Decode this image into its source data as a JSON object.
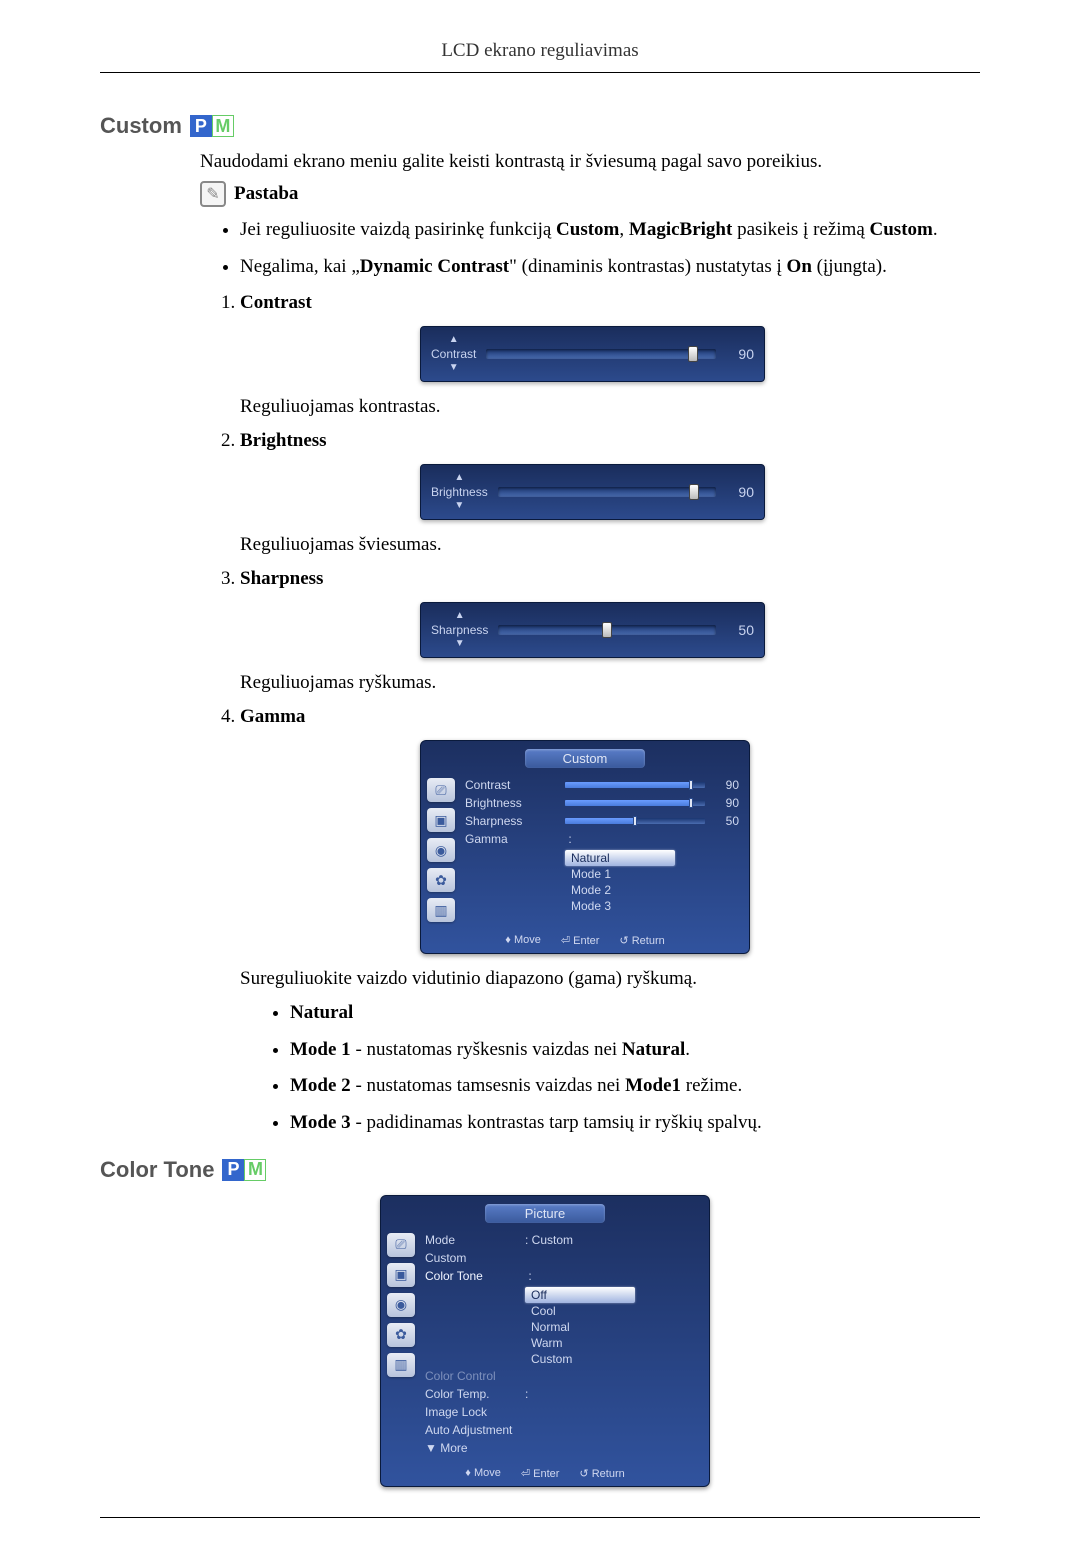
{
  "header": "LCD ekrano reguliavimas",
  "section1": {
    "title": "Custom",
    "intro": "Naudodami ekrano meniu galite keisti kontrastą ir šviesumą pagal savo poreikius.",
    "note_label": "Pastaba",
    "bullet1_pre": "Jei reguliuosite vaizdą pasirinkę funkciją ",
    "bullet1_b1": "Custom",
    "bullet1_mid": ", ",
    "bullet1_b2": "MagicBright",
    "bullet1_mid2": " pasikeis į režimą ",
    "bullet1_b3": "Custom",
    "bullet1_end": ".",
    "bullet2_pre": "Negalima, kai „",
    "bullet2_b1": "Dynamic Contrast",
    "bullet2_mid": "\" (dinaminis kontrastas) nustatytas į ",
    "bullet2_b2": "On",
    "bullet2_end": " (įjungta).",
    "items": [
      {
        "label": "Contrast",
        "slider_name": "Contrast",
        "value": "90",
        "thumb_pct": 90,
        "desc": "Reguliuojamas kontrastas."
      },
      {
        "label": "Brightness",
        "slider_name": "Brightness",
        "value": "90",
        "thumb_pct": 90,
        "desc": "Reguliuojamas šviesumas."
      },
      {
        "label": "Sharpness",
        "slider_name": "Sharpness",
        "value": "50",
        "thumb_pct": 50,
        "desc": "Reguliuojamas ryškumas."
      },
      {
        "label": "Gamma"
      }
    ]
  },
  "gamma_osd": {
    "tab": "Custom",
    "rows": [
      {
        "label": "Contrast",
        "val": "90",
        "pct": 90
      },
      {
        "label": "Brightness",
        "val": "90",
        "pct": 90
      },
      {
        "label": "Sharpness",
        "val": "50",
        "pct": 50
      }
    ],
    "gamma_label": "Gamma",
    "gamma_value_sel": "Natural",
    "options": [
      "Natural",
      "Mode 1",
      "Mode 2",
      "Mode 3"
    ],
    "footer": {
      "move": "Move",
      "enter": "Enter",
      "return": "Return"
    }
  },
  "gamma_desc": "Sureguliuokite vaizdo vidutinio diapazono (gama) ryškumą.",
  "gamma_modes": {
    "natural": "Natural",
    "m1_b": "Mode 1",
    "m1_t": " - nustatomas ryškesnis vaizdas nei ",
    "m1_b2": "Natural",
    "m1_end": ".",
    "m2_b": "Mode 2",
    "m2_t": " - nustatomas tamsesnis vaizdas nei ",
    "m2_b2": "Mode1",
    "m2_end": " režime.",
    "m3_b": "Mode 3",
    "m3_t": " - padidinamas kontrastas tarp tamsių ir ryškių spalvų."
  },
  "section2": {
    "title": "Color Tone"
  },
  "picture_osd": {
    "tab": "Picture",
    "rows": [
      {
        "label": "Mode",
        "value": ": Custom"
      },
      {
        "label": "Custom",
        "value": ""
      },
      {
        "label": "Color Tone",
        "value": "",
        "hl": true
      }
    ],
    "options_label": "Off",
    "options": [
      "Off",
      "Cool",
      "Normal",
      "Warm",
      "Custom"
    ],
    "after_rows": [
      {
        "label": "Color Control",
        "value": "",
        "dim": true
      },
      {
        "label": "Color Temp.",
        "value": ":"
      },
      {
        "label": "Image Lock",
        "value": ""
      },
      {
        "label": "Auto Adjustment",
        "value": ""
      }
    ],
    "more": "▼ More",
    "footer": {
      "move": "Move",
      "enter": "Enter",
      "return": "Return"
    }
  }
}
